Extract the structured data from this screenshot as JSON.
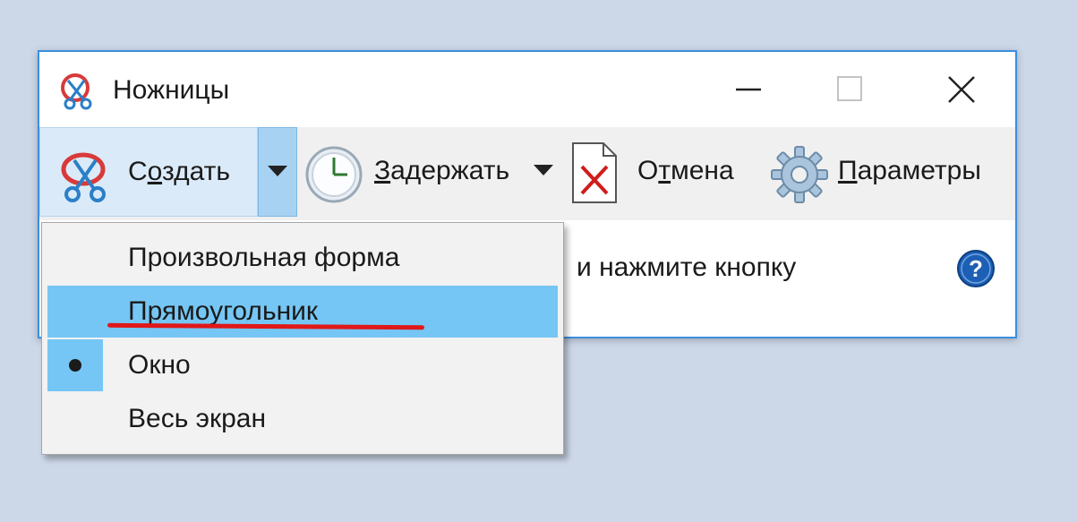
{
  "window": {
    "title": "Ножницы",
    "controls": {
      "minimize": "minimize-icon",
      "maximize": "maximize-icon",
      "close": "close-icon"
    }
  },
  "toolbar": {
    "new_label": "Создать",
    "new_mnemonic_prefix": "С",
    "new_mnemonic_char": "о",
    "new_mnemonic_suffix": "здать",
    "delay_mnemonic_char": "З",
    "delay_rest": "адержать",
    "cancel_prefix": "О",
    "cancel_mnemonic_char": "т",
    "cancel_suffix": "мена",
    "options_mnemonic_char": "П",
    "options_rest": "араметры"
  },
  "status": {
    "text": "и нажмите кнопку"
  },
  "mode_menu": {
    "items": [
      {
        "label": "Произвольная форма",
        "selected": false,
        "highlighted": false
      },
      {
        "label": "Прямоугольник",
        "selected": false,
        "highlighted": true
      },
      {
        "label": "Окно",
        "selected": true,
        "highlighted": false
      },
      {
        "label": "Весь экран",
        "selected": false,
        "highlighted": false
      }
    ]
  },
  "colors": {
    "accent": "#3a8ee0",
    "menu_highlight": "#75c6f4",
    "annotation": "#e01818"
  }
}
